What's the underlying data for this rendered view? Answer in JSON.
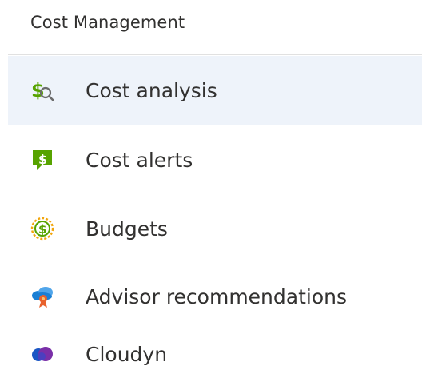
{
  "section": {
    "title": "Cost Management"
  },
  "menu": {
    "items": [
      {
        "label": "Cost analysis",
        "icon": "cost-analysis-icon",
        "selected": true
      },
      {
        "label": "Cost alerts",
        "icon": "cost-alerts-icon",
        "selected": false
      },
      {
        "label": "Budgets",
        "icon": "budgets-icon",
        "selected": false
      },
      {
        "label": "Advisor recommendations",
        "icon": "advisor-recommendations-icon",
        "selected": false
      },
      {
        "label": "Cloudyn",
        "icon": "cloudyn-icon",
        "selected": false
      }
    ]
  },
  "colors": {
    "selected_background": "#eef3fa",
    "divider": "#e1e1e1",
    "text": "#323130",
    "green": "#57a300",
    "gold": "#f2a60d",
    "blue": "#1a7fd4",
    "orange": "#e8612c",
    "purple": "#7a2fa8"
  }
}
